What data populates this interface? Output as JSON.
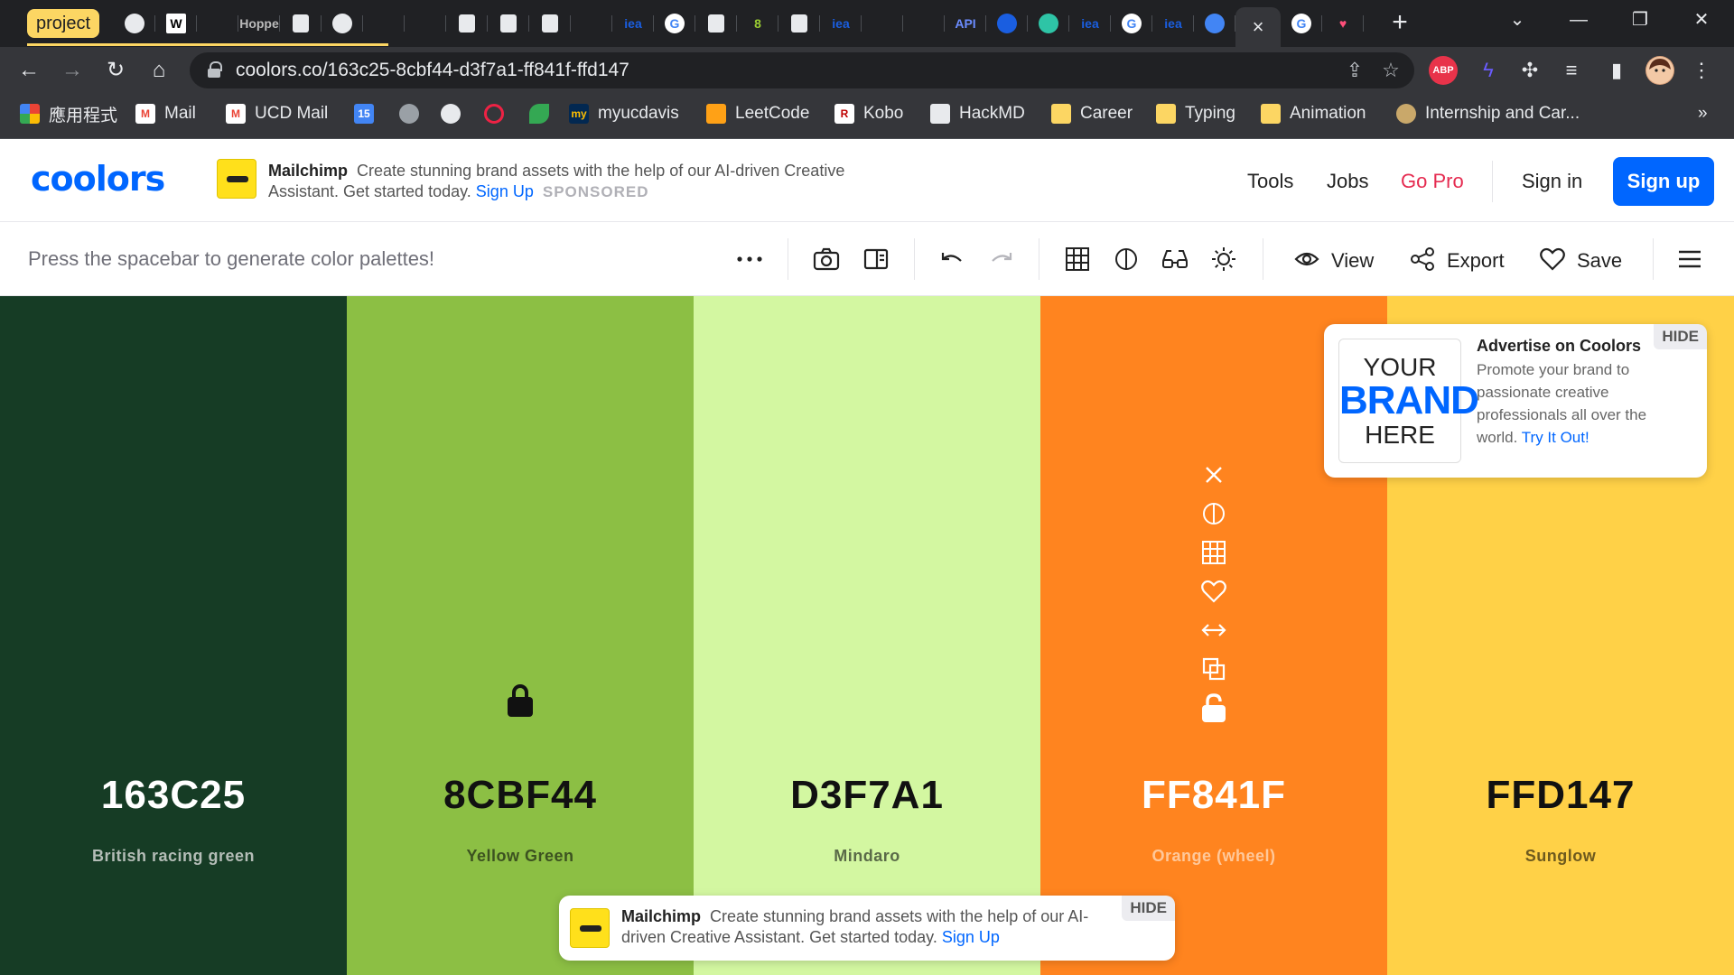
{
  "browser": {
    "tab_group_label": "project",
    "url": "coolors.co/163c25-8cbf44-d3f7a1-ff841f-ffd147",
    "tabs": [
      {
        "icon": "globe-icon",
        "label": ""
      },
      {
        "icon": "wikipedia-icon",
        "label": "W"
      },
      {
        "icon": "settings-wheel-icon",
        "label": ""
      },
      {
        "icon": "hoppe-icon",
        "label": "Hoppe"
      },
      {
        "icon": "document-icon",
        "label": ""
      },
      {
        "icon": "globe-icon",
        "label": ""
      },
      {
        "icon": "pirate-icon",
        "label": ""
      },
      {
        "icon": "speaker-icon",
        "label": ""
      },
      {
        "icon": "page-thumb-icon",
        "label": ""
      },
      {
        "icon": "square-icon",
        "label": ""
      },
      {
        "icon": "square-icon",
        "label": ""
      },
      {
        "icon": "blue-swirl-icon",
        "label": ""
      },
      {
        "icon": "iea-icon",
        "label": "iea"
      },
      {
        "icon": "google-icon",
        "label": "G"
      },
      {
        "icon": "square-icon",
        "label": ""
      },
      {
        "icon": "eight-icon",
        "label": "8"
      },
      {
        "icon": "square-icon",
        "label": ""
      },
      {
        "icon": "iea-icon",
        "label": "iea"
      },
      {
        "icon": "github-icon",
        "label": ""
      },
      {
        "icon": "book-icon",
        "label": ""
      },
      {
        "icon": "api-icon",
        "label": "API"
      },
      {
        "icon": "blue-circle-icon",
        "label": ""
      },
      {
        "icon": "teal-icon",
        "label": ""
      },
      {
        "icon": "iea-icon",
        "label": "iea"
      },
      {
        "icon": "google-icon",
        "label": "G"
      },
      {
        "icon": "iea-icon",
        "label": "iea"
      },
      {
        "icon": "chrome-icon",
        "label": ""
      },
      {
        "icon": "close-icon",
        "label": "×"
      },
      {
        "icon": "google-icon",
        "label": "G"
      },
      {
        "icon": "heart-icon",
        "label": "♥"
      }
    ],
    "bookmarks": [
      {
        "icon": "apps-grid-icon",
        "label": "應用程式"
      },
      {
        "icon": "gmail-icon",
        "label": "Mail"
      },
      {
        "icon": "gmail-icon",
        "label": "UCD Mail"
      },
      {
        "icon": "calendar-icon",
        "label": ""
      },
      {
        "icon": "apple-icon",
        "label": ""
      },
      {
        "icon": "github-icon",
        "label": ""
      },
      {
        "icon": "target-icon",
        "label": ""
      },
      {
        "icon": "leaf-icon",
        "label": ""
      },
      {
        "icon": "my-icon",
        "label": "myucdavis"
      },
      {
        "icon": "leetcode-icon",
        "label": "LeetCode"
      },
      {
        "icon": "kobo-icon",
        "label": "Kobo"
      },
      {
        "icon": "doc-icon",
        "label": "HackMD"
      },
      {
        "icon": "folder-icon",
        "label": "Career"
      },
      {
        "icon": "folder-icon",
        "label": "Typing"
      },
      {
        "icon": "folder-icon",
        "label": "Animation"
      },
      {
        "icon": "globe-icon",
        "label": "Internship and Car..."
      }
    ],
    "calendar_day": "15",
    "more_bookmarks": "»",
    "ext_abp": "ABP"
  },
  "header": {
    "logo": "coolors",
    "ad": {
      "brand": "Mailchimp",
      "text": "Create stunning brand assets with the help of our AI-driven Creative Assistant. Get started today.",
      "link": "Sign Up",
      "sponsored": "SPONSORED"
    },
    "nav": {
      "tools": "Tools",
      "jobs": "Jobs",
      "go_pro": "Go Pro",
      "sign_in": "Sign in",
      "sign_up": "Sign up"
    },
    "go_pro_color": "#e52b50",
    "accent": "#0066ff"
  },
  "toolbar": {
    "hint": "Press the spacebar to generate color palettes!",
    "view": "View",
    "export": "Export",
    "save": "Save"
  },
  "palette": [
    {
      "hex": "163C25",
      "name": "British racing green",
      "bg": "#163c25",
      "text_color": "#ffffff",
      "name_color": "#b4bdb7",
      "locked": false,
      "show_tools": false
    },
    {
      "hex": "8CBF44",
      "name": "Yellow Green",
      "bg": "#8cbf44",
      "text_color": "#111111",
      "name_color": "#3c5220",
      "locked": true,
      "show_tools": false
    },
    {
      "hex": "D3F7A1",
      "name": "Mindaro",
      "bg": "#d3f7a1",
      "text_color": "#111111",
      "name_color": "#5a6a48",
      "locked": false,
      "show_tools": false
    },
    {
      "hex": "FF841F",
      "name": "Orange (wheel)",
      "bg": "#ff841f",
      "text_color": "#ffffff",
      "name_color": "#ffc89a",
      "locked": false,
      "show_tools": true
    },
    {
      "hex": "FFD147",
      "name": "Sunglow",
      "bg": "#ffd147",
      "text_color": "#111111",
      "name_color": "#6e5a1e",
      "locked": false,
      "show_tools": false
    }
  ],
  "advertise": {
    "brand_your": "YOUR",
    "brand_brand": "BRAND",
    "brand_here": "HERE",
    "title": "Advertise on Coolors",
    "body": "Promote your brand to passionate creative professionals all over the world.",
    "link": "Try It Out!",
    "hide": "HIDE"
  },
  "bottom_ad": {
    "brand": "Mailchimp",
    "text": "Create stunning brand assets with the help of our AI-driven Creative Assistant. Get started today.",
    "link": "Sign Up",
    "hide": "HIDE"
  }
}
